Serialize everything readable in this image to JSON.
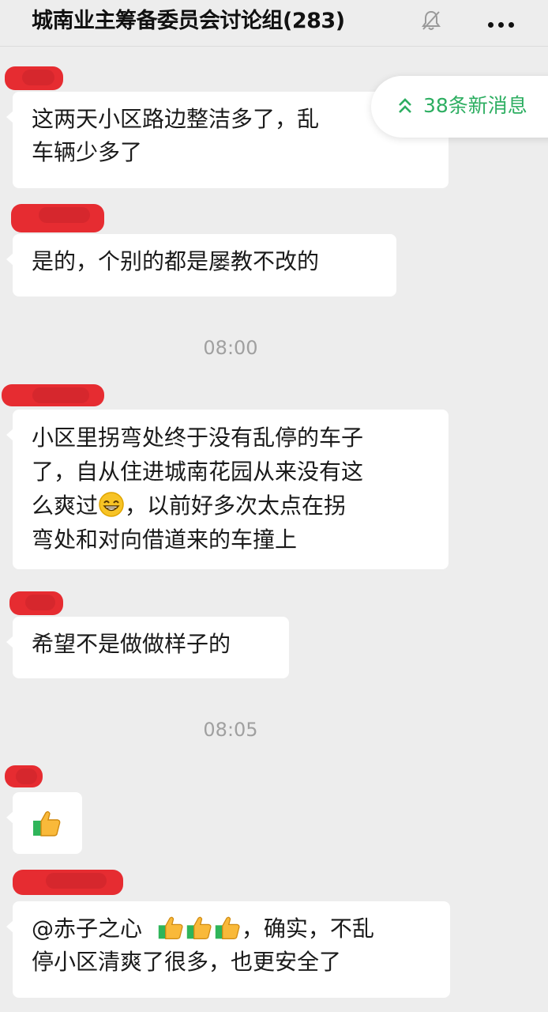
{
  "header": {
    "title": "城南业主筹备委员会讨论组(283)",
    "mute_icon": "bell-muted-icon",
    "more_icon": "more-dots-icon"
  },
  "new_messages": {
    "label": "38条新消息",
    "icon": "double-chevron-up-icon",
    "color": "#2dae61"
  },
  "messages": [
    {
      "text_line1": "这两天小区路边整洁多了，乱",
      "text_line2": "车辆少多了"
    },
    {
      "text": "是的，个别的都是屡教不改的"
    },
    {
      "text_line1": "小区里拐弯处终于没有乱停的车子",
      "text_line2": "了，自从住进城南花园从来没有这",
      "text_line3_a": "么爽过",
      "text_line3_b": "，以前好多次太点在拐",
      "text_line4": "弯处和对向借道来的车撞上"
    },
    {
      "text": "希望不是做做样子的"
    },
    {
      "emoji": "thumbs-up-icon"
    },
    {
      "mention": "@赤子之心",
      "text_line1_b": "，确实，不乱",
      "text_line2": "停小区清爽了很多，也更安全了"
    }
  ],
  "timestamps": [
    "08:00",
    "08:05"
  ],
  "colors": {
    "background": "#ededed",
    "bubble": "#ffffff",
    "redaction": "#e61c22"
  }
}
